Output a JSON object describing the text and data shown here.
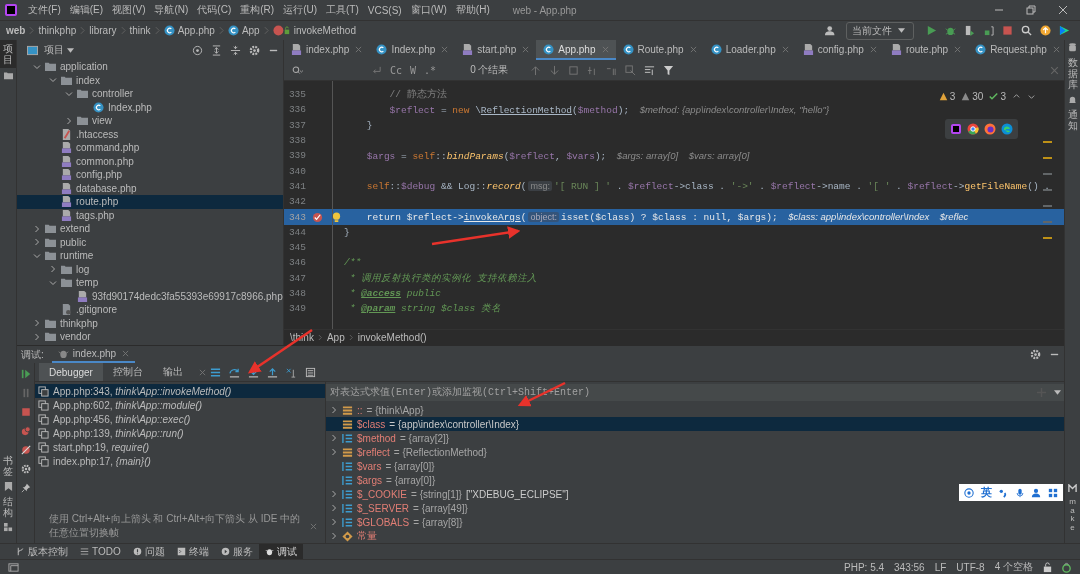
{
  "menu_bar": {
    "items": [
      "文件(F)",
      "编辑(E)",
      "视图(V)",
      "导航(N)",
      "代码(C)",
      "重构(R)",
      "运行(U)",
      "工具(T)",
      "VCS(S)",
      "窗口(W)",
      "帮助(H)"
    ],
    "title": "web - App.php"
  },
  "nav_bar": {
    "crumbs": [
      {
        "label": "web",
        "kind": "root"
      },
      {
        "label": "thinkphp",
        "kind": "dir"
      },
      {
        "label": "library",
        "kind": "dir"
      },
      {
        "label": "think",
        "kind": "dir"
      },
      {
        "label": "App.php",
        "kind": "class"
      },
      {
        "label": "App",
        "kind": "class"
      },
      {
        "label": "invokeMethod",
        "kind": "method"
      }
    ],
    "run_config": "当前文件"
  },
  "left_strip": {
    "top": "项目",
    "bottom": [
      "书签",
      "结构"
    ]
  },
  "project_panel": {
    "title": "项目",
    "tree": [
      {
        "name": "application",
        "kind": "folder",
        "expanded": true,
        "selected": false,
        "children": [
          {
            "name": "index",
            "kind": "folder",
            "expanded": true,
            "selected": false,
            "children": [
              {
                "name": "controller",
                "kind": "folder",
                "expanded": true,
                "selected": false,
                "children": [
                  {
                    "name": "Index.php",
                    "kind": "class",
                    "selected": false
                  }
                ]
              },
              {
                "name": "view",
                "kind": "folder",
                "expanded": false,
                "selected": false
              }
            ]
          },
          {
            "name": ".htaccess",
            "kind": "htaccess",
            "selected": false
          },
          {
            "name": "command.php",
            "kind": "php",
            "selected": false
          },
          {
            "name": "common.php",
            "kind": "php",
            "selected": false
          },
          {
            "name": "config.php",
            "kind": "php",
            "selected": false
          },
          {
            "name": "database.php",
            "kind": "php",
            "selected": false
          },
          {
            "name": "route.php",
            "kind": "php",
            "selected": true
          },
          {
            "name": "tags.php",
            "kind": "php",
            "selected": false
          }
        ]
      },
      {
        "name": "extend",
        "kind": "folder",
        "expanded": false,
        "selected": false
      },
      {
        "name": "public",
        "kind": "folder",
        "expanded": false,
        "selected": false
      },
      {
        "name": "runtime",
        "kind": "folder",
        "expanded": true,
        "selected": false,
        "children": [
          {
            "name": "log",
            "kind": "folder",
            "expanded": false,
            "selected": false
          },
          {
            "name": "temp",
            "kind": "folder",
            "expanded": true,
            "selected": false,
            "children": [
              {
                "name": "93fd90174dedc3fa55393e69917c8966.php",
                "kind": "php",
                "selected": false
              }
            ]
          },
          {
            "name": ".gitignore",
            "kind": "git",
            "selected": false
          }
        ]
      },
      {
        "name": "thinkphp",
        "kind": "folder",
        "expanded": false,
        "selected": false
      },
      {
        "name": "vendor",
        "kind": "folder",
        "expanded": false,
        "selected": false
      }
    ]
  },
  "tabs": [
    {
      "label": "index.php",
      "kind": "php",
      "selected": false
    },
    {
      "label": "Index.php",
      "kind": "class",
      "selected": false
    },
    {
      "label": "start.php",
      "kind": "php",
      "selected": false
    },
    {
      "label": "App.php",
      "kind": "class",
      "selected": true
    },
    {
      "label": "Route.php",
      "kind": "class",
      "selected": false
    },
    {
      "label": "Loader.php",
      "kind": "class",
      "selected": false
    },
    {
      "label": "config.php",
      "kind": "php",
      "selected": false
    },
    {
      "label": "route.php",
      "kind": "php",
      "selected": false
    },
    {
      "label": "Request.php",
      "kind": "class",
      "selected": false
    }
  ],
  "editor": {
    "find": {
      "case": "Cc",
      "word": "W",
      "regex": ".*",
      "results": "0 个结果"
    },
    "inspections": {
      "errors": "3",
      "warnings": "30",
      "ok": "3"
    },
    "lines": [
      {
        "number": "335",
        "current": false,
        "tokens": [
          {
            "kind": "comment",
            "text": "        // 静态方法"
          }
        ]
      },
      {
        "number": "336",
        "current": false,
        "tokens": [
          {
            "kind": "var",
            "text": "        $reflect"
          },
          {
            "kind": "plain",
            "text": " = "
          },
          {
            "kind": "kw",
            "text": "new"
          },
          {
            "kind": "plain",
            "text": " \\"
          },
          {
            "kind": "cls",
            "text": "ReflectionMethod"
          },
          {
            "kind": "plain",
            "text": "("
          },
          {
            "kind": "var",
            "text": "$method"
          },
          {
            "kind": "plain",
            "text": ");"
          },
          {
            "kind": "hint",
            "text": "$method: {app\\index\\controller\\Index, \"hello\"}"
          }
        ]
      },
      {
        "number": "337",
        "current": false,
        "tokens": [
          {
            "kind": "plain",
            "text": "    }"
          }
        ]
      },
      {
        "number": "338",
        "current": false
      },
      {
        "number": "339",
        "current": false,
        "tokens": [
          {
            "kind": "var",
            "text": "    $args"
          },
          {
            "kind": "plain",
            "text": " = "
          },
          {
            "kind": "kw",
            "text": "self"
          },
          {
            "kind": "plain",
            "text": "::"
          },
          {
            "kind": "fn",
            "text": "bindParams"
          },
          {
            "kind": "plain",
            "text": "("
          },
          {
            "kind": "var",
            "text": "$reflect"
          },
          {
            "kind": "plain",
            "text": ", "
          },
          {
            "kind": "var",
            "text": "$vars"
          },
          {
            "kind": "plain",
            "text": ");"
          },
          {
            "kind": "hint",
            "text": "$args: array[0]    $vars: array[0]"
          }
        ]
      },
      {
        "number": "340",
        "current": false
      },
      {
        "number": "341",
        "current": false,
        "tokens": [
          {
            "kind": "kw",
            "text": "    self"
          },
          {
            "kind": "plain",
            "text": "::"
          },
          {
            "kind": "var",
            "text": "$debug"
          },
          {
            "kind": "plain",
            "text": " && Log::"
          },
          {
            "kind": "fn",
            "text": "record"
          },
          {
            "kind": "plain",
            "text": "("
          },
          {
            "kind": "param",
            "text": "msg:"
          },
          {
            "kind": "str",
            "text": "'[ RUN ] '"
          },
          {
            "kind": "plain",
            "text": " . "
          },
          {
            "kind": "var",
            "text": "$reflect"
          },
          {
            "kind": "plain",
            "text": "->class . "
          },
          {
            "kind": "str",
            "text": "'->'"
          },
          {
            "kind": "plain",
            "text": " . "
          },
          {
            "kind": "var",
            "text": "$reflect"
          },
          {
            "kind": "plain",
            "text": "->name . "
          },
          {
            "kind": "str",
            "text": "'[ '"
          },
          {
            "kind": "plain",
            "text": " . "
          },
          {
            "kind": "var",
            "text": "$reflect"
          },
          {
            "kind": "plain",
            "text": "->"
          },
          {
            "kind": "method",
            "text": "getFileName"
          },
          {
            "kind": "plain",
            "text": "() ."
          }
        ]
      },
      {
        "number": "342",
        "current": false
      },
      {
        "number": "343",
        "current": true,
        "breakpoint": true,
        "tokens": [
          {
            "kind": "kw",
            "text": "    return "
          },
          {
            "kind": "var",
            "text": "$reflect"
          },
          {
            "kind": "plain",
            "text": "->"
          },
          {
            "kind": "call",
            "text": "invokeArgs"
          },
          {
            "kind": "plain",
            "text": "("
          },
          {
            "kind": "param",
            "text": "object:"
          },
          {
            "kind": "kw",
            "text": "isset"
          },
          {
            "kind": "plain",
            "text": "("
          },
          {
            "kind": "var",
            "text": "$class"
          },
          {
            "kind": "plain",
            "text": ") ? "
          },
          {
            "kind": "var",
            "text": "$class"
          },
          {
            "kind": "plain",
            "text": " : "
          },
          {
            "kind": "kw",
            "text": "null"
          },
          {
            "kind": "plain",
            "text": ", "
          },
          {
            "kind": "var",
            "text": "$args"
          },
          {
            "kind": "plain",
            "text": ");"
          },
          {
            "kind": "hint",
            "text": "$class: app\\index\\controller\\Index    $reflec"
          }
        ]
      },
      {
        "number": "344",
        "current": false,
        "tokens": [
          {
            "kind": "plain",
            "text": "}"
          }
        ]
      },
      {
        "number": "345",
        "current": false
      },
      {
        "number": "346",
        "current": false,
        "tokens": [
          {
            "kind": "doc",
            "text": "/**"
          }
        ]
      },
      {
        "number": "347",
        "current": false,
        "tokens": [
          {
            "kind": "doc",
            "text": " * 调用反射执行类的实例化 支持依赖注入"
          }
        ]
      },
      {
        "number": "348",
        "current": false,
        "tokens": [
          {
            "kind": "doc",
            "text": " * "
          },
          {
            "kind": "tag",
            "text": "@access"
          },
          {
            "kind": "doc",
            "text": " public"
          }
        ]
      },
      {
        "number": "349",
        "current": false,
        "tokens": [
          {
            "kind": "doc",
            "text": " * "
          },
          {
            "kind": "tag",
            "text": "@param"
          },
          {
            "kind": "doc",
            "text": " string $class 类名"
          }
        ]
      }
    ],
    "breadcrumbs": [
      "\\think",
      "App",
      "invokeMethod()"
    ]
  },
  "right_strip": [
    "数据库",
    "通知",
    "make"
  ],
  "debug": {
    "label": "调试:",
    "session": "index.php",
    "tabs": [
      {
        "label": "Debugger",
        "selected": true
      },
      {
        "label": "控制台",
        "selected": false
      },
      {
        "label": "输出",
        "selected": false
      }
    ],
    "frames": [
      {
        "location": "App.php:343,",
        "method": "think\\App::invokeMethod()",
        "selected": true
      },
      {
        "location": "App.php:602,",
        "method": "think\\App::module()",
        "selected": false
      },
      {
        "location": "App.php:456,",
        "method": "think\\App::exec()",
        "selected": false
      },
      {
        "location": "App.php:139,",
        "method": "think\\App::run()",
        "selected": false
      },
      {
        "location": "start.php:19,",
        "method": "require()",
        "selected": false
      },
      {
        "location": "index.php:17,",
        "method": "{main}()",
        "selected": false
      }
    ],
    "hint": "使用 Ctrl+Alt+向上箭头 和 Ctrl+Alt+向下箭头 从 IDE 中的任意位置切换帧",
    "eval_placeholder": "对表达式求值(Enter)或添加监视(Ctrl+Shift+Enter)",
    "variables": [
      {
        "name": "::",
        "value": "= {think\\App}",
        "kind": "object",
        "expandable": true,
        "selected": false
      },
      {
        "name": "$class",
        "value": "= {app\\index\\controller\\Index}",
        "kind": "object",
        "expandable": false,
        "selected": true
      },
      {
        "name": "$method",
        "value": "= {array[2]}",
        "kind": "array",
        "expandable": true,
        "selected": false
      },
      {
        "name": "$reflect",
        "value": "= {ReflectionMethod}",
        "kind": "object",
        "expandable": true,
        "selected": false
      },
      {
        "name": "$vars",
        "value": "= {array[0]}",
        "kind": "array",
        "expandable": false,
        "selected": false
      },
      {
        "name": "$args",
        "value": "= {array[0]}",
        "kind": "array",
        "expandable": false,
        "selected": false
      },
      {
        "name": "$_COOKIE",
        "value": "= {string[1]}",
        "extra": "[\"XDEBUG_ECLIPSE\"]",
        "kind": "array",
        "expandable": true,
        "selected": false
      },
      {
        "name": "$_SERVER",
        "value": "= {array[49]}",
        "kind": "array",
        "expandable": true,
        "selected": false
      },
      {
        "name": "$GLOBALS",
        "value": "= {array[8]}",
        "kind": "array",
        "expandable": true,
        "selected": false
      },
      {
        "name": "常量",
        "kind": "const",
        "expandable": true,
        "selected": false
      }
    ]
  },
  "tool_windows": [
    {
      "label": "版本控制",
      "kind": "vcs",
      "selected": false
    },
    {
      "label": "TODO",
      "kind": "todo",
      "selected": false
    },
    {
      "label": "问题",
      "kind": "problems",
      "selected": false
    },
    {
      "label": "终端",
      "kind": "terminal",
      "selected": false
    },
    {
      "label": "服务",
      "kind": "services",
      "selected": false
    },
    {
      "label": "调试",
      "kind": "debug",
      "selected": true
    }
  ],
  "status_bar": {
    "items": [
      "PHP: 5.4",
      "343:56",
      "LF",
      "UTF-8",
      "4 个空格"
    ]
  },
  "ime_toolbar": {
    "label": "英"
  }
}
